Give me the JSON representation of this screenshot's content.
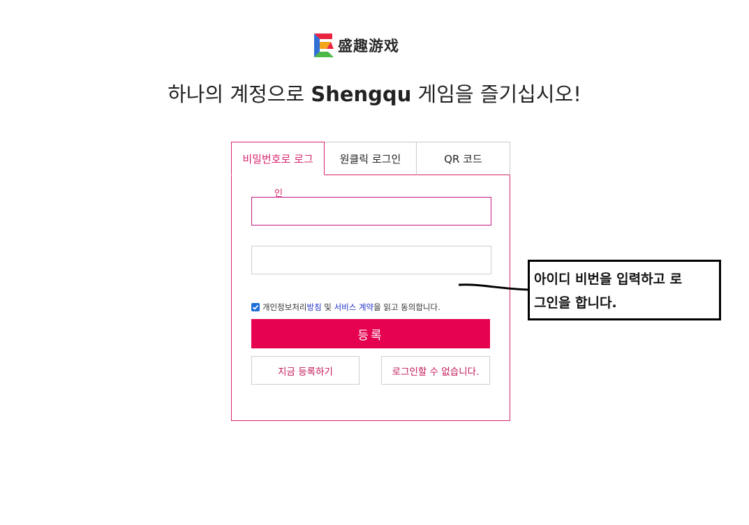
{
  "brand": {
    "logo_text": "盛趣游戏"
  },
  "headline": {
    "prefix": "하나의 계정으로 ",
    "brand": "Shengqu",
    "suffix": " 게임을 즐기십시오!"
  },
  "login_card": {
    "tabs": [
      {
        "label": "비밀번호로 로그",
        "active": true
      },
      {
        "label": "원클릭 로그인",
        "active": false
      },
      {
        "label": "QR 코드",
        "active": false
      }
    ],
    "id_field": {
      "floating_label": "인",
      "value": ""
    },
    "password_field": {
      "value": ""
    },
    "agreement": {
      "checked": true,
      "text_1": "개인정보처리",
      "link_1": "방침",
      "text_2": " 및 ",
      "link_2": "서비스 계약",
      "text_3": "을 읽고 동의합니다."
    },
    "register_label": "등록",
    "signup_label": "지금 등록하기",
    "cant_login_label": "로그인할 수 없습니다."
  },
  "annotation": {
    "line_1": "아이디 비번을 입력하고 로",
    "line_2": "그인을 합니다."
  },
  "colors": {
    "accent": "#e50050",
    "accent_text": "#d6246e",
    "link": "#2033c9",
    "checkbox": "#1e6fd9"
  }
}
